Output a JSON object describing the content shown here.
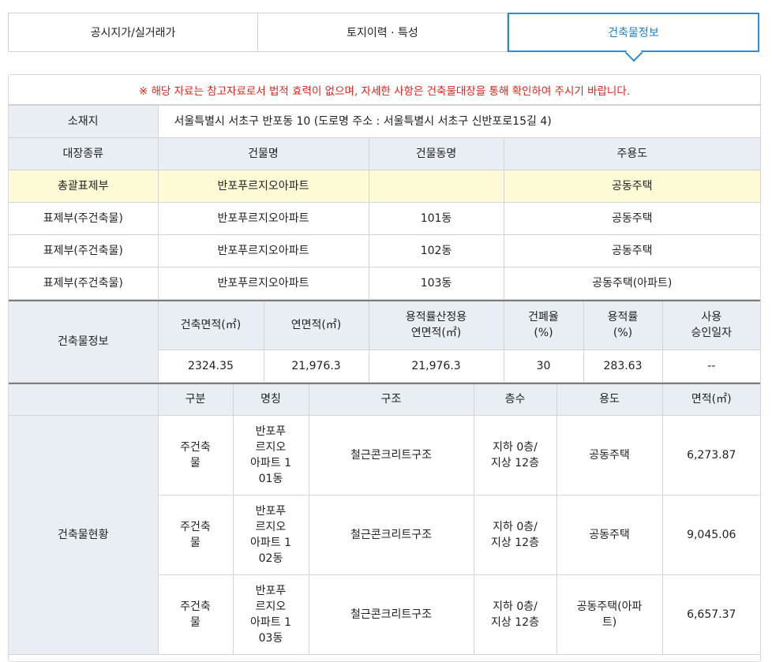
{
  "tabs": [
    "공시지가/실거래가",
    "토지이력 · 특성",
    "건축물정보"
  ],
  "notice": "※ 해당 자료는 참고자료로서 법적 효력이 없으며, 자세한 사항은 건축물대장을 통해 확인하여 주시기 바랍니다.",
  "location": {
    "label": "소재지",
    "value": "서울특별시 서초구 반포동 10 (도로명 주소 : 서울특별시 서초구 신반포로15길 4)"
  },
  "register": {
    "headers": [
      "대장종류",
      "건물명",
      "건물동명",
      "주용도"
    ],
    "rows": [
      {
        "type": "총괄표제부",
        "name": "반포푸르지오아파트",
        "dong": "",
        "use": "공동주택"
      },
      {
        "type": "표제부(주건축물)",
        "name": "반포푸르지오아파트",
        "dong": "101동",
        "use": "공동주택"
      },
      {
        "type": "표제부(주건축물)",
        "name": "반포푸르지오아파트",
        "dong": "102동",
        "use": "공동주택"
      },
      {
        "type": "표제부(주건축물)",
        "name": "반포푸르지오아파트",
        "dong": "103동",
        "use": "공동주택(아파트)"
      }
    ]
  },
  "building_info": {
    "label": "건축물정보",
    "headers": {
      "building_area": "건축면적(㎡)",
      "total_floor_area": "연면적(㎡)",
      "far_area_line1": "용적률산정용",
      "far_area_line2": "연면적(㎡)",
      "bcr_line1": "건폐율",
      "bcr_line2": "(%)",
      "far_line1": "용적률",
      "far_line2": "(%)",
      "approval_line1": "사용",
      "approval_line2": "승인일자"
    },
    "values": {
      "building_area": "2324.35",
      "total_floor_area": "21,976.3",
      "far_area": "21,976.3",
      "bcr": "30",
      "far": "283.63",
      "approval": "--"
    }
  },
  "status": {
    "label": "건축물현황",
    "headers": [
      "구분",
      "명칭",
      "구조",
      "층수",
      "용도",
      "면적(㎡)"
    ],
    "rows": [
      {
        "cat": "주건축\n물",
        "name": "반포푸\n르지오\n아파트 1\n01동",
        "structure": "철근콘크리트구조",
        "floors": "지하 0층/\n지상 12층",
        "use": "공동주택",
        "area": "6,273.87"
      },
      {
        "cat": "주건축\n물",
        "name": "반포푸\n르지오\n아파트 1\n02동",
        "structure": "철근콘크리트구조",
        "floors": "지하 0층/\n지상 12층",
        "use": "공동주택",
        "area": "9,045.06"
      },
      {
        "cat": "주건축\n물",
        "name": "반포푸\n르지오\n아파트 1\n03동",
        "structure": "철근콘크리트구조",
        "floors": "지하 0층/\n지상 12층",
        "use": "공동주택(아파\n트)",
        "area": "6,657.37"
      }
    ]
  }
}
